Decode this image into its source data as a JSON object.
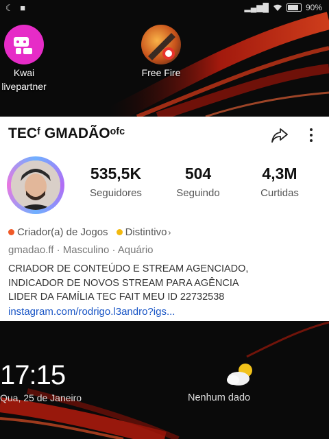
{
  "status_bar": {
    "battery_text": "90%",
    "battery_level": 0.9
  },
  "apps": [
    {
      "label_line1": "Kwai",
      "label_line2": "livepartner",
      "icon": "kwai-logo-icon"
    },
    {
      "label_line1": "Free Fire",
      "icon": "free-fire-icon"
    }
  ],
  "profile": {
    "name": "TECᶠ GMADÃOᵒᶠᶜ",
    "stats": [
      {
        "value": "535,5K",
        "label": "Seguidores"
      },
      {
        "value": "504",
        "label": "Seguindo"
      },
      {
        "value": "4,3M",
        "label": "Curtidas"
      }
    ],
    "tag_creator": "Criador(a) de Jogos",
    "tag_badge": "Distintivo",
    "meta": "gmadao.ff · Masculino · Aquário",
    "bio_lines": [
      "CRIADOR DE CONTEÚDO E STREAM AGENCIADO,",
      "INDICADOR DE NOVOS STREAM PARA AGÊNCIA",
      "LIDER DA FAMÍLIA TEC FAIT MEU ID 22732538"
    ],
    "link": "instagram.com/rodrigo.l3andro?igs..."
  },
  "lockscreen": {
    "time": "17:15",
    "date": "Qua, 25 de Janeiro",
    "weather_text": "Nenhum dado"
  },
  "colors": {
    "accent_red": "#d42a1a",
    "link_blue": "#1a56c6",
    "creator_dot": "#f05a28",
    "badge_dot": "#f2b90f"
  }
}
